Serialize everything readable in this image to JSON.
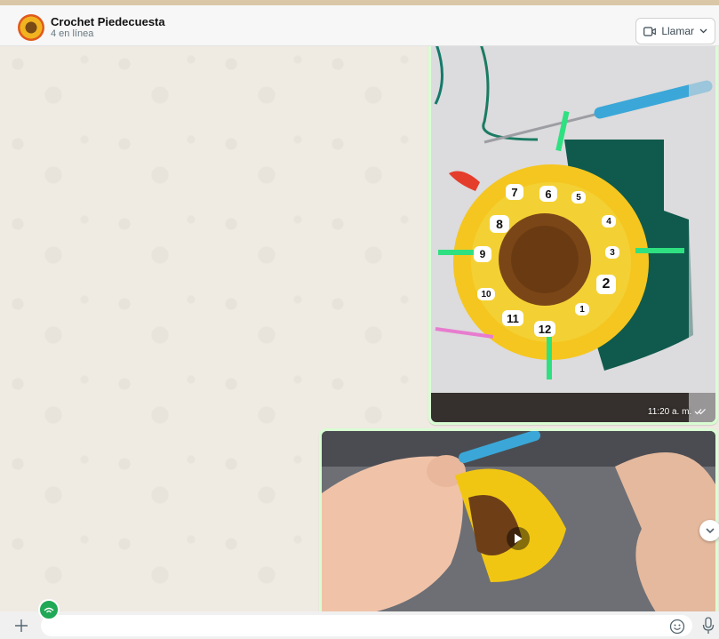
{
  "chat": {
    "name": "Crochet Piedecuesta",
    "status": "4 en línea"
  },
  "header": {
    "call_label": "Llamar"
  },
  "messages": [
    {
      "type": "image",
      "time": "11:20 a. m.",
      "petal_numbers": [
        "7",
        "6",
        "5",
        "8",
        "4",
        "9",
        "3",
        "2",
        "10",
        "1",
        "11",
        "12"
      ]
    },
    {
      "type": "video"
    }
  ],
  "icons": {
    "avatar": "group-avatar",
    "call": "video-camera-icon",
    "call_chevron": "chevron-down-icon",
    "play": "play-icon",
    "scroll": "chevron-down-icon",
    "attach": "plus-icon",
    "emoji": "emoji-icon",
    "mic": "microphone-icon",
    "sticker": "sticker-icon",
    "read": "double-check-icon"
  },
  "colors": {
    "outgoing_bubble": "#d9fdd3",
    "chat_background": "#efeae2",
    "accent_green": "#1fa855"
  }
}
